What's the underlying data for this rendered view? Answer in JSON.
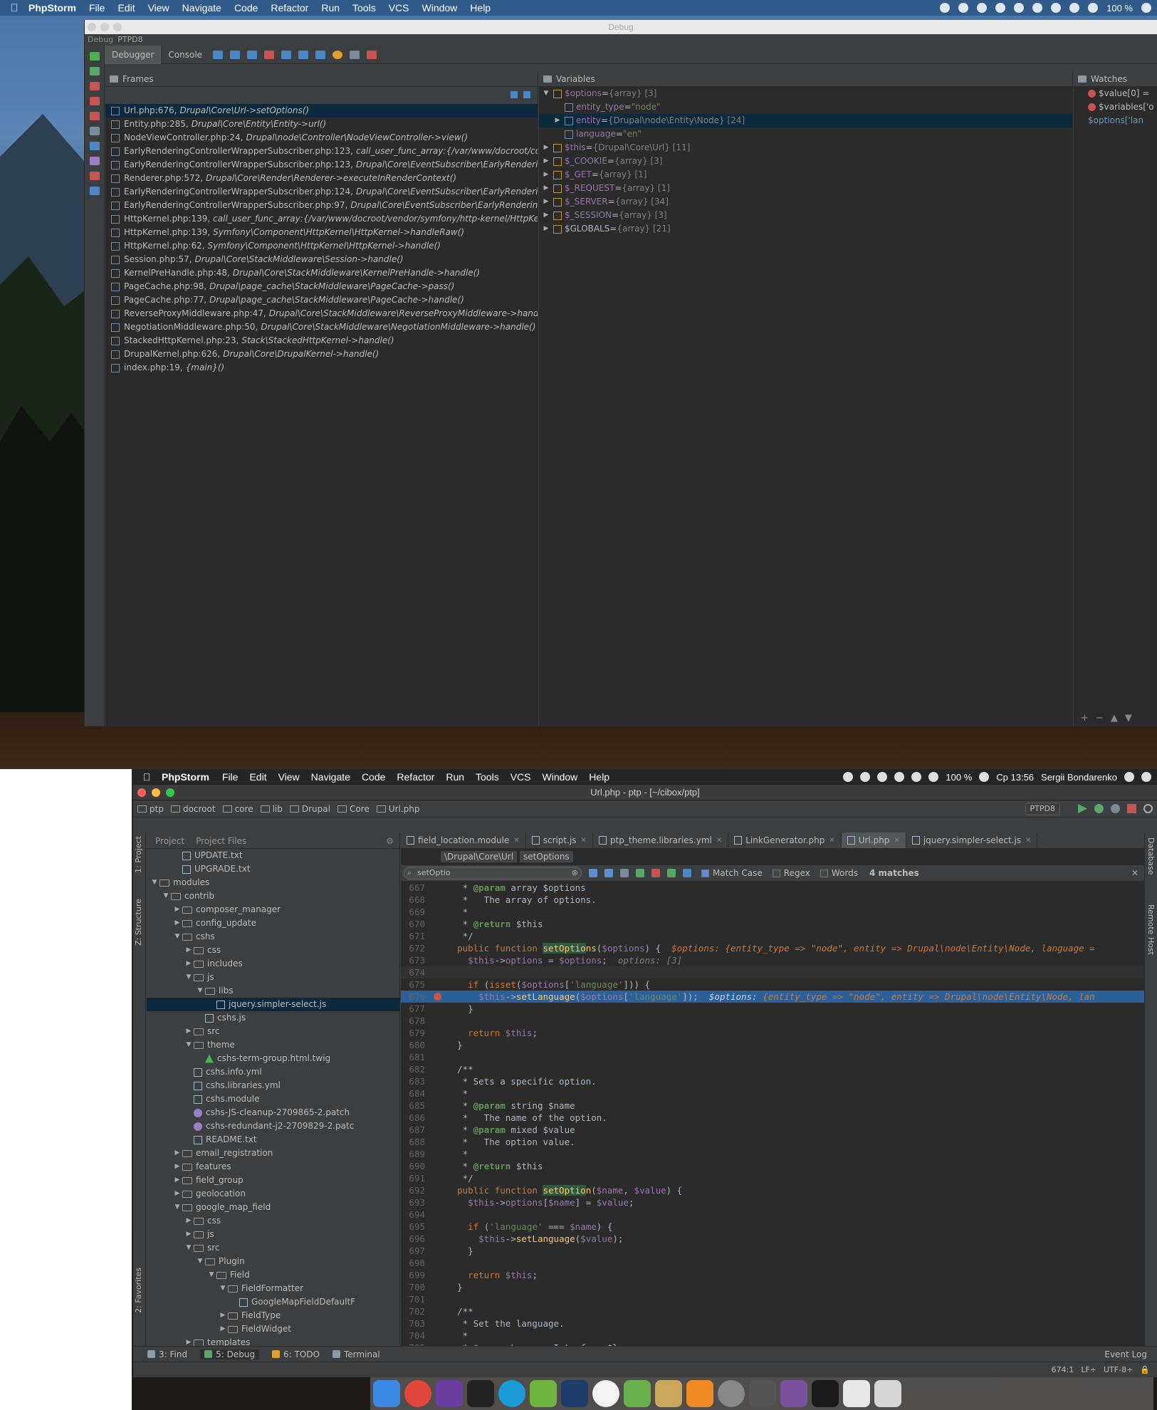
{
  "top_menubar": {
    "app": "PhpStorm",
    "items": [
      "File",
      "Edit",
      "View",
      "Navigate",
      "Code",
      "Refactor",
      "Run",
      "Tools",
      "VCS",
      "Window",
      "Help"
    ],
    "battery": "100 %"
  },
  "debug_window": {
    "title": "Debug",
    "tab_label": "Debug",
    "run_config": "PTPD8",
    "toolbar_tabs": [
      "Debugger",
      "Console"
    ],
    "frames": {
      "header": "Frames",
      "rows": [
        {
          "file": "Url.php:676,",
          "call": "Drupal\\Core\\Url->setOptions()"
        },
        {
          "file": "Entity.php:285,",
          "call": "Drupal\\Core\\Entity\\Entity->url()"
        },
        {
          "file": "NodeViewController.php:24,",
          "call": "Drupal\\node\\Controller\\NodeViewController->view()"
        },
        {
          "file": "EarlyRenderingControllerWrapperSubscriber.php:123,",
          "call": "call_user_func_array:{/var/www/docroot/core,"
        },
        {
          "file": "EarlyRenderingControllerWrapperSubscriber.php:123,",
          "call": "Drupal\\Core\\EventSubscriber\\EarlyRendering"
        },
        {
          "file": "Renderer.php:572,",
          "call": "Drupal\\Core\\Render\\Renderer->executeInRenderContext()"
        },
        {
          "file": "EarlyRenderingControllerWrapperSubscriber.php:124,",
          "call": "Drupal\\Core\\EventSubscriber\\EarlyRendering"
        },
        {
          "file": "EarlyRenderingControllerWrapperSubscriber.php:97,",
          "call": "Drupal\\Core\\EventSubscriber\\EarlyRenderingC"
        },
        {
          "file": "HttpKernel.php:139,",
          "call": "call_user_func_array:{/var/www/docroot/vendor/symfony/http-kernel/HttpKer"
        },
        {
          "file": "HttpKernel.php:139,",
          "call": "Symfony\\Component\\HttpKernel\\HttpKernel->handleRaw()"
        },
        {
          "file": "HttpKernel.php:62,",
          "call": "Symfony\\Component\\HttpKernel\\HttpKernel->handle()"
        },
        {
          "file": "Session.php:57,",
          "call": "Drupal\\Core\\StackMiddleware\\Session->handle()"
        },
        {
          "file": "KernelPreHandle.php:48,",
          "call": "Drupal\\Core\\StackMiddleware\\KernelPreHandle->handle()"
        },
        {
          "file": "PageCache.php:98,",
          "call": "Drupal\\page_cache\\StackMiddleware\\PageCache->pass()"
        },
        {
          "file": "PageCache.php:77,",
          "call": "Drupal\\page_cache\\StackMiddleware\\PageCache->handle()"
        },
        {
          "file": "ReverseProxyMiddleware.php:47,",
          "call": "Drupal\\Core\\StackMiddleware\\ReverseProxyMiddleware->handle"
        },
        {
          "file": "NegotiationMiddleware.php:50,",
          "call": "Drupal\\Core\\StackMiddleware\\NegotiationMiddleware->handle()"
        },
        {
          "file": "StackedHttpKernel.php:23,",
          "call": "Stack\\StackedHttpKernel->handle()"
        },
        {
          "file": "DrupalKernel.php:626,",
          "call": "Drupal\\Core\\DrupalKernel->handle()"
        },
        {
          "file": "index.php:19,",
          "call": "{main}()"
        }
      ]
    },
    "variables": {
      "header": "Variables",
      "rows": [
        {
          "tri": "▼",
          "name": "$options",
          "eq": " = ",
          "type": "{array} [3]",
          "val": "",
          "indent": 0,
          "color": "purple"
        },
        {
          "tri": "",
          "name": "entity_type",
          "eq": " = ",
          "type": "",
          "val": "\"node\"",
          "indent": 1,
          "color": "purple"
        },
        {
          "tri": "▶",
          "name": "entity",
          "eq": " = ",
          "type": "{Drupal\\node\\Entity\\Node} [24]",
          "val": "",
          "indent": 1,
          "color": "purple"
        },
        {
          "tri": "",
          "name": "language",
          "eq": " = ",
          "type": "",
          "val": "\"en\"",
          "indent": 1,
          "color": "purple"
        },
        {
          "tri": "▶",
          "name": "$this",
          "eq": " = ",
          "type": "{Drupal\\Core\\Url} [11]",
          "val": "",
          "indent": 0,
          "color": "purple"
        },
        {
          "tri": "▶",
          "name": "$_COOKIE",
          "eq": " = ",
          "type": "{array} [3]",
          "val": "",
          "indent": 0,
          "color": "purple"
        },
        {
          "tri": "▶",
          "name": "$_GET",
          "eq": " = ",
          "type": "{array} [1]",
          "val": "",
          "indent": 0,
          "color": "purple"
        },
        {
          "tri": "▶",
          "name": "$_REQUEST",
          "eq": " = ",
          "type": "{array} [1]",
          "val": "",
          "indent": 0,
          "color": "purple"
        },
        {
          "tri": "▶",
          "name": "$_SERVER",
          "eq": " = ",
          "type": "{array} [34]",
          "val": "",
          "indent": 0,
          "color": "purple"
        },
        {
          "tri": "▶",
          "name": "$_SESSION",
          "eq": " = ",
          "type": "{array} [3]",
          "val": "",
          "indent": 0,
          "color": "purple"
        },
        {
          "tri": "▶",
          "name": "$GLOBALS",
          "eq": " = ",
          "type": "{array} [21]",
          "val": "",
          "indent": 0,
          "color": "blue"
        }
      ]
    },
    "watches": {
      "header": "Watches",
      "rows": [
        {
          "err": true,
          "text": "$value[0] = "
        },
        {
          "err": true,
          "text": "$variables['o"
        },
        {
          "err": false,
          "text": "$options['lan"
        }
      ]
    }
  },
  "bottom_menubar": {
    "app": "PhpStorm",
    "items": [
      "File",
      "Edit",
      "View",
      "Navigate",
      "Code",
      "Refactor",
      "Run",
      "Tools",
      "VCS",
      "Window",
      "Help"
    ],
    "battery": "100 %",
    "clock": "Cp 13:56",
    "user": "Sergii Bondarenko"
  },
  "ide": {
    "title": "Url.php - ptp - [~/cibox/ptp]",
    "breadcrumbs": [
      "ptp",
      "docroot",
      "core",
      "lib",
      "Drupal",
      "Core",
      "Url.php"
    ],
    "run_config": "PTPD8",
    "left_tabs": [
      "1: Project",
      "Z: Structure",
      "2: Favorites"
    ],
    "right_tabs": [
      "Database",
      "Remote Host"
    ],
    "project_tabs": [
      "Project",
      "Project Files"
    ],
    "tree": [
      {
        "d": 4,
        "arr": "",
        "k": "file",
        "t": "UPDATE.txt"
      },
      {
        "d": 4,
        "arr": "",
        "k": "file",
        "t": "UPGRADE.txt"
      },
      {
        "d": 2,
        "arr": "▼",
        "k": "folder",
        "t": "modules"
      },
      {
        "d": 3,
        "arr": "▼",
        "k": "folder",
        "t": "contrib"
      },
      {
        "d": 4,
        "arr": "▶",
        "k": "folder",
        "t": "composer_manager"
      },
      {
        "d": 4,
        "arr": "▶",
        "k": "folder",
        "t": "config_update"
      },
      {
        "d": 4,
        "arr": "▼",
        "k": "folder",
        "t": "cshs"
      },
      {
        "d": 5,
        "arr": "▶",
        "k": "folder",
        "t": "css"
      },
      {
        "d": 5,
        "arr": "▶",
        "k": "folder",
        "t": "includes"
      },
      {
        "d": 5,
        "arr": "▼",
        "k": "folder",
        "t": "js"
      },
      {
        "d": 6,
        "arr": "▼",
        "k": "folder",
        "t": "libs"
      },
      {
        "d": 7,
        "arr": "",
        "k": "file",
        "t": "jquery.simpler-select.js",
        "sel": true
      },
      {
        "d": 6,
        "arr": "",
        "k": "file",
        "t": "cshs.js"
      },
      {
        "d": 5,
        "arr": "▶",
        "k": "folder",
        "t": "src"
      },
      {
        "d": 5,
        "arr": "▼",
        "k": "folder",
        "t": "theme"
      },
      {
        "d": 6,
        "arr": "",
        "k": "twig",
        "t": "cshs-term-group.html.twig"
      },
      {
        "d": 5,
        "arr": "",
        "k": "file",
        "t": "cshs.info.yml"
      },
      {
        "d": 5,
        "arr": "",
        "k": "file",
        "t": "cshs.libraries.yml"
      },
      {
        "d": 5,
        "arr": "",
        "k": "file",
        "t": "cshs.module"
      },
      {
        "d": 5,
        "arr": "",
        "k": "patch",
        "t": "cshs-JS-cleanup-2709865-2.patch"
      },
      {
        "d": 5,
        "arr": "",
        "k": "patch",
        "t": "cshs-redundant-j2-2709829-2.patc"
      },
      {
        "d": 5,
        "arr": "",
        "k": "file",
        "t": "README.txt"
      },
      {
        "d": 4,
        "arr": "▶",
        "k": "folder",
        "t": "email_registration"
      },
      {
        "d": 4,
        "arr": "▶",
        "k": "folder",
        "t": "features"
      },
      {
        "d": 4,
        "arr": "▶",
        "k": "folder",
        "t": "field_group"
      },
      {
        "d": 4,
        "arr": "▶",
        "k": "folder",
        "t": "geolocation"
      },
      {
        "d": 4,
        "arr": "▼",
        "k": "folder",
        "t": "google_map_field"
      },
      {
        "d": 5,
        "arr": "▶",
        "k": "folder",
        "t": "css"
      },
      {
        "d": 5,
        "arr": "▶",
        "k": "folder",
        "t": "js"
      },
      {
        "d": 5,
        "arr": "▼",
        "k": "folder",
        "t": "src"
      },
      {
        "d": 6,
        "arr": "▼",
        "k": "folder",
        "t": "Plugin"
      },
      {
        "d": 7,
        "arr": "▼",
        "k": "folder",
        "t": "Field"
      },
      {
        "d": 8,
        "arr": "▼",
        "k": "folder",
        "t": "FieldFormatter"
      },
      {
        "d": 9,
        "arr": "",
        "k": "file",
        "t": "GoogleMapFieldDefaultF"
      },
      {
        "d": 8,
        "arr": "▶",
        "k": "folder",
        "t": "FieldType"
      },
      {
        "d": 8,
        "arr": "▶",
        "k": "folder",
        "t": "FieldWidget"
      },
      {
        "d": 5,
        "arr": "▶",
        "k": "folder",
        "t": "templates"
      }
    ],
    "tabs": [
      {
        "t": "field_location.module",
        "active": false
      },
      {
        "t": "script.js",
        "active": false
      },
      {
        "t": "ptp_theme.libraries.yml",
        "active": false
      },
      {
        "t": "LinkGenerator.php",
        "active": false
      },
      {
        "t": "Url.php",
        "active": true
      },
      {
        "t": "jquery.simpler-select.js",
        "active": false
      }
    ],
    "code_crumbs": [
      "\\Drupal\\Core\\Url",
      "setOptions"
    ],
    "search": {
      "value": "setOptio",
      "match_case": "Match Case",
      "regex": "Regex",
      "words": "Words",
      "matches": "4 matches"
    },
    "bottom_tabs": [
      "3: Find",
      "5: Debug",
      "6: TODO",
      "Terminal"
    ],
    "event_log": "Event Log",
    "status": {
      "pos": "674:1",
      "lf": "LF÷",
      "enc": "UTF-8÷"
    }
  }
}
